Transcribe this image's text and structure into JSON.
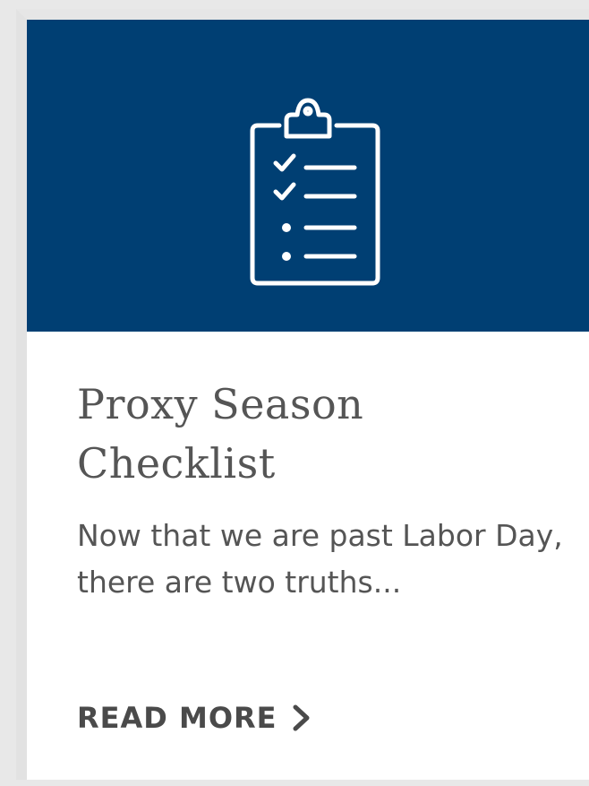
{
  "card": {
    "icon": "clipboard-checklist-icon",
    "title": "Proxy Season Checklist",
    "excerpt": "Now that we are past Labor Day, there are two truths...",
    "read_more_label": "READ MORE",
    "read_more_icon": "chevron-right-icon"
  },
  "colors": {
    "hero_background": "#003f73",
    "text": "#555555",
    "card_background": "#ffffff"
  }
}
